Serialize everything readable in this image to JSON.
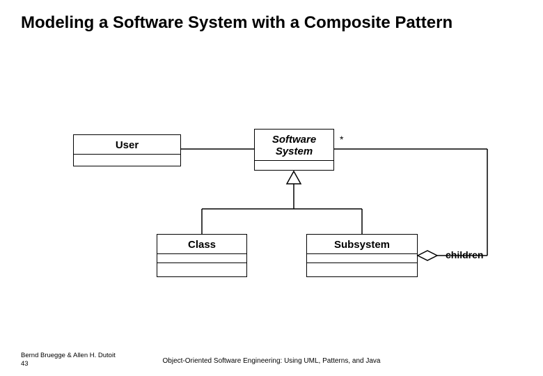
{
  "slide": {
    "title": "Modeling a Software System with a Composite Pattern"
  },
  "uml": {
    "user": {
      "name": "User"
    },
    "software_system": {
      "name": "Software\nSystem"
    },
    "class": {
      "name": "Class"
    },
    "subsystem": {
      "name": "Subsystem"
    }
  },
  "labels": {
    "multiplicity_star": "*",
    "children_role": "children"
  },
  "footer": {
    "authors": "Bernd Bruegge & Allen H. Dutoit",
    "page": "43",
    "book": "Object-Oriented Software Engineering: Using UML, Patterns, and Java"
  }
}
